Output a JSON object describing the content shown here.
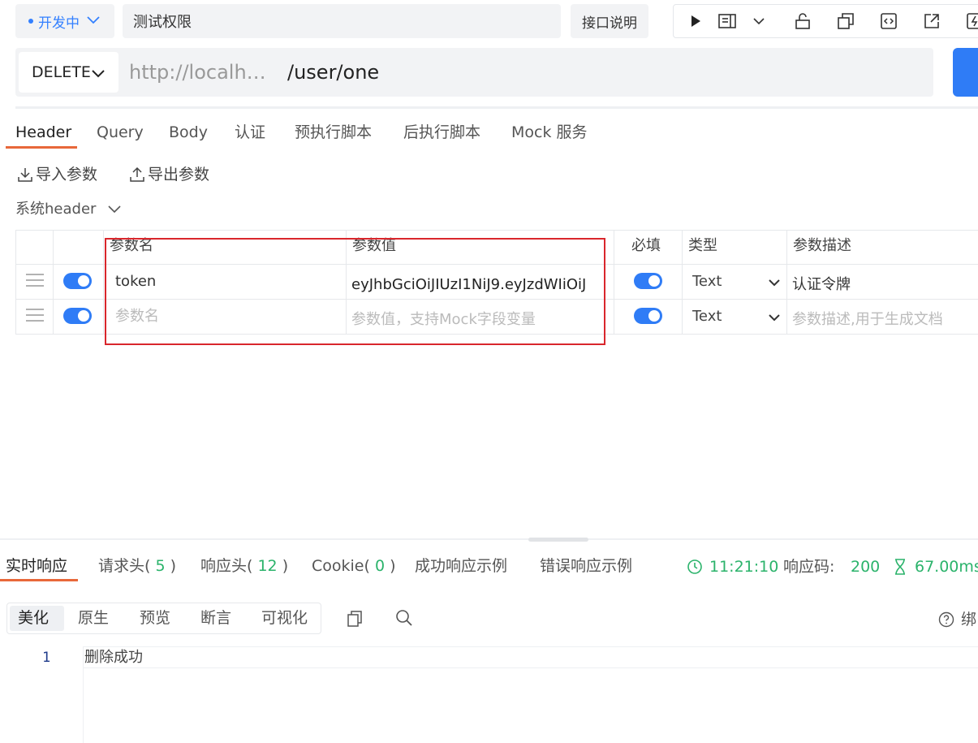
{
  "top": {
    "status": "开发中",
    "api_name": "测试权限",
    "doc_button": "接口说明",
    "toolbar_icons": [
      "play-icon",
      "doc-view-icon",
      "chevron-down-icon",
      "unlock-icon",
      "copy-icon",
      "code-icon",
      "share-icon",
      "flash-icon"
    ]
  },
  "url": {
    "method": "DELETE",
    "host": "http://localh…",
    "path": "/user/one"
  },
  "tabs": [
    "Header",
    "Query",
    "Body",
    "认证",
    "预执行脚本",
    "后执行脚本",
    "Mock 服务"
  ],
  "tools": {
    "import": "导入参数",
    "export": "导出参数",
    "sys_header": "系统header"
  },
  "table": {
    "headers": {
      "name": "参数名",
      "value": "参数值",
      "required": "必填",
      "type": "类型",
      "desc": "参数描述"
    },
    "rows": [
      {
        "name": "token",
        "value": "eyJhbGciOiJIUzI1NiJ9.eyJzdWIiOiJ",
        "type": "Text",
        "desc": "认证令牌",
        "required": true,
        "enabled": true
      }
    ],
    "new_row": {
      "name_placeholder": "参数名",
      "value_placeholder": "参数值，支持Mock字段变量",
      "type": "Text",
      "desc_placeholder": "参数描述,用于生成文档",
      "required": true,
      "enabled": true
    }
  },
  "response": {
    "tabs": {
      "realtime": "实时响应",
      "req_headers": "请求头(",
      "req_headers_count": "5",
      "resp_headers": "响应头(",
      "resp_headers_count": "12",
      "cookie": "Cookie(",
      "cookie_count": "0",
      "close_paren": ")",
      "success_example": "成功响应示例",
      "error_example": "错误响应示例"
    },
    "time": "11:21:10",
    "code_label": "响应码:",
    "code": "200",
    "duration": "67.00ms",
    "view_modes": [
      "美化",
      "原生",
      "预览",
      "断言",
      "可视化"
    ],
    "bind_label": "绑",
    "line_number": "1",
    "body": "删除成功"
  },
  "colors": {
    "accent": "#2f7cf6",
    "tab_underline": "#e8683a",
    "success": "#2bb36b",
    "highlight_box": "#d9262c"
  }
}
